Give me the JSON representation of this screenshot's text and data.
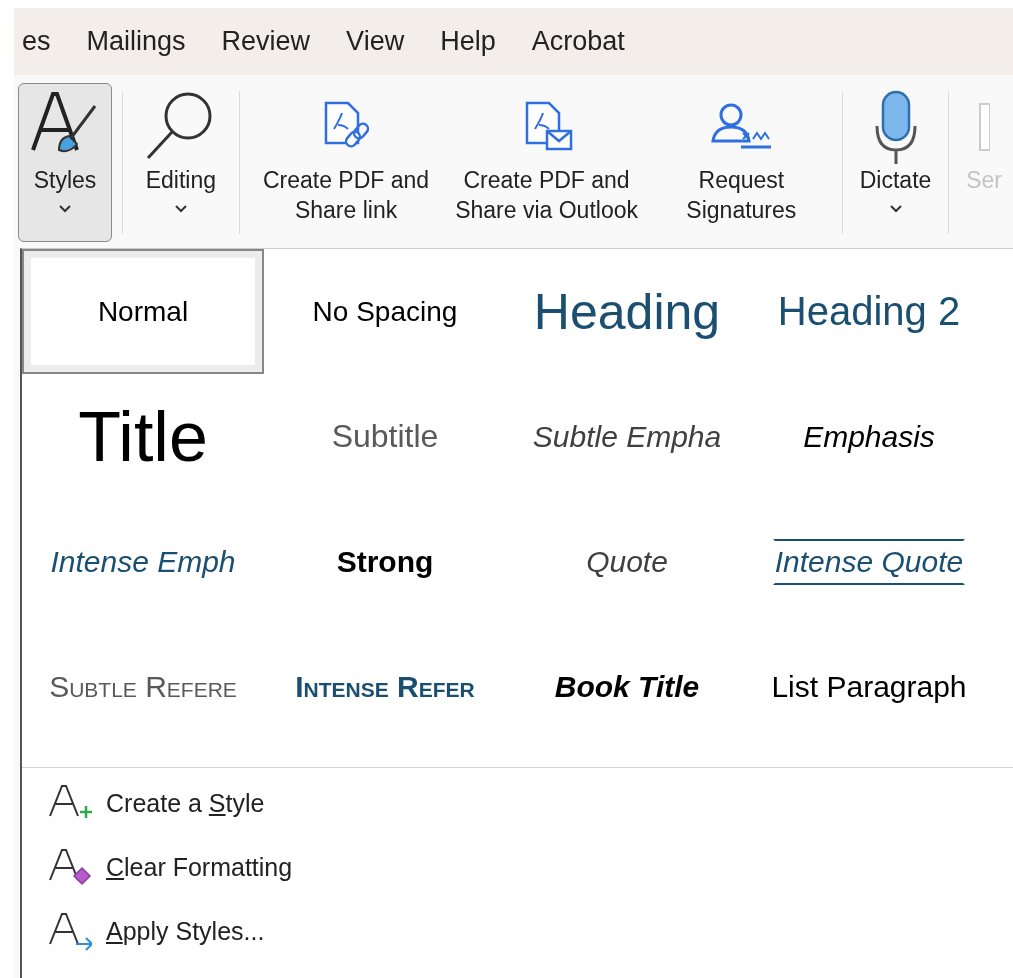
{
  "tabs": [
    {
      "label": "es",
      "selected": false
    },
    {
      "label": "Mailings",
      "selected": false
    },
    {
      "label": "Review",
      "selected": false
    },
    {
      "label": "View",
      "selected": false
    },
    {
      "label": "Help",
      "selected": false
    },
    {
      "label": "Acrobat",
      "selected": false
    }
  ],
  "ribbon": {
    "buttons": [
      {
        "kind": "styles",
        "label": "Styles",
        "dropdown": true,
        "selected": true,
        "disabled": false
      },
      {
        "kind": "editing",
        "label": "Editing",
        "dropdown": true,
        "selected": false,
        "disabled": false
      },
      {
        "kind": "pdf_link",
        "label": "Create PDF and Share link",
        "dropdown": false,
        "selected": false,
        "disabled": false
      },
      {
        "kind": "pdf_mail",
        "label": "Create PDF and Share via Outlook",
        "dropdown": false,
        "selected": false,
        "disabled": false
      },
      {
        "kind": "signature",
        "label": "Request Signatures",
        "dropdown": false,
        "selected": false,
        "disabled": false
      },
      {
        "kind": "dictate",
        "label": "Dictate",
        "dropdown": true,
        "selected": false,
        "disabled": false
      },
      {
        "kind": "cut",
        "label": "Ser",
        "dropdown": false,
        "selected": false,
        "disabled": true
      }
    ]
  },
  "styles_gallery": {
    "items": [
      {
        "kind": "normal",
        "label": "Normal",
        "selected": true
      },
      {
        "kind": "no_spacing",
        "label": "No Spacing",
        "selected": false
      },
      {
        "kind": "heading1",
        "label": "Heading",
        "selected": false
      },
      {
        "kind": "heading2",
        "label": "Heading 2",
        "selected": false
      },
      {
        "kind": "title",
        "label": "Title",
        "selected": false
      },
      {
        "kind": "subtitle",
        "label": "Subtitle",
        "selected": false
      },
      {
        "kind": "subtle_emphasis",
        "label": "Subtle Empha",
        "selected": false
      },
      {
        "kind": "emphasis",
        "label": "Emphasis",
        "selected": false
      },
      {
        "kind": "intense_emphasis",
        "label": "Intense Emph",
        "selected": false
      },
      {
        "kind": "strong",
        "label": "Strong",
        "selected": false
      },
      {
        "kind": "quote",
        "label": "Quote",
        "selected": false
      },
      {
        "kind": "intense_quote",
        "label": "Intense Quote",
        "selected": false
      },
      {
        "kind": "subtle_reference",
        "label": "Subtle Refere",
        "selected": false
      },
      {
        "kind": "intense_reference",
        "label": "Intense Refer",
        "selected": false
      },
      {
        "kind": "book_title",
        "label": "Book Title",
        "selected": false
      },
      {
        "kind": "list_paragraph",
        "label": "List Paragraph",
        "selected": false
      }
    ]
  },
  "menu": [
    {
      "kind": "create",
      "before": "Create a ",
      "key": "S",
      "after": "tyle"
    },
    {
      "kind": "clear",
      "key": "C",
      "after": "lear Formatting"
    },
    {
      "kind": "apply",
      "key": "A",
      "after": "pply Styles..."
    }
  ]
}
